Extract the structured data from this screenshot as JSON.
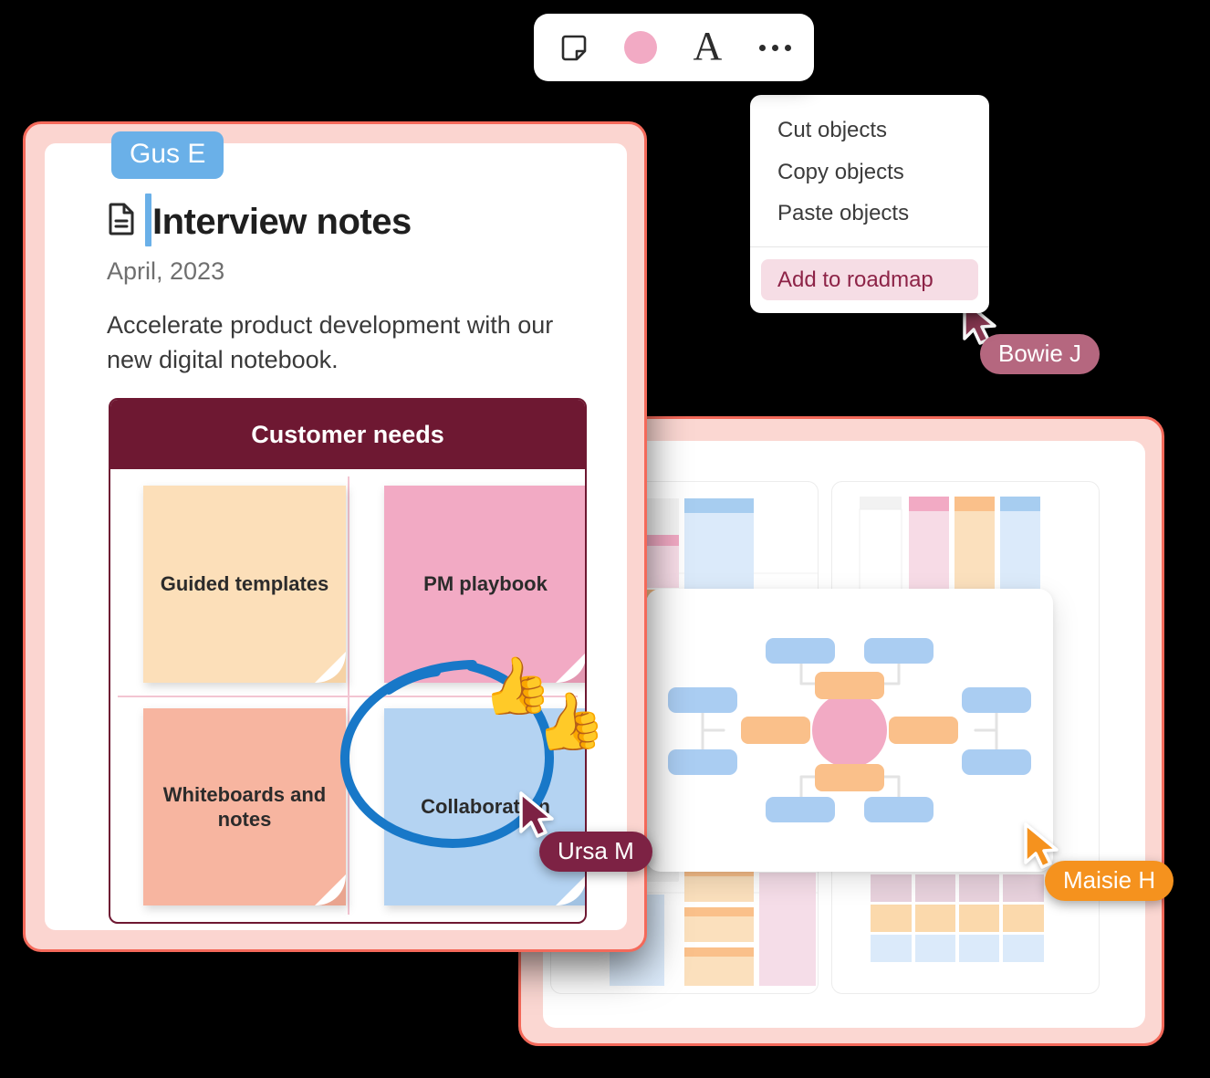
{
  "toolbar": {
    "items": [
      {
        "name": "sticky-note-tool",
        "icon": "sticky-note-icon",
        "label": ""
      },
      {
        "name": "color-swatch-tool",
        "icon": "color-circle-icon",
        "label": "",
        "color": "#f2aac4"
      },
      {
        "name": "text-tool",
        "icon": "text-A-icon",
        "label": "A"
      },
      {
        "name": "more-options",
        "icon": "ellipsis-icon",
        "label": ""
      }
    ]
  },
  "context_menu": {
    "items": [
      {
        "label": "Cut objects",
        "highlight": false
      },
      {
        "label": "Copy objects",
        "highlight": false
      },
      {
        "label": "Paste objects",
        "highlight": false
      }
    ],
    "action": {
      "label": "Add to roadmap",
      "highlight": true,
      "bg": "#f6dde5",
      "fg": "#8d2347"
    }
  },
  "document": {
    "icon": "document-icon",
    "title": "Interview notes",
    "date": "April, 2023",
    "body": "Accelerate product development with our new digital notebook.",
    "border_color": "#f4695a",
    "frame_color": "#fbd5d0"
  },
  "matrix": {
    "header": "Customer needs",
    "header_bg": "#6e1832",
    "border_color": "#6e1832",
    "notes": [
      {
        "label": "Guided templates",
        "color": "#fcdfb9",
        "quadrant": "top-left"
      },
      {
        "label": "PM playbook",
        "color": "#f2aac4",
        "quadrant": "top-right"
      },
      {
        "label": "Whiteboards and notes",
        "color": "#f7b5a0",
        "quadrant": "bottom-left"
      },
      {
        "label": "Collaboration",
        "color": "#b4d3f2",
        "quadrant": "bottom-right"
      }
    ],
    "annotation": {
      "type": "hand-drawn-circle",
      "color": "#1878c8",
      "target": "Collaboration"
    },
    "reactions": [
      "👍",
      "👍"
    ]
  },
  "board": {
    "border_color": "#f4695a",
    "frame_color": "#fbd7d2",
    "panels": [
      {
        "name": "timeline-panel",
        "position": "left"
      },
      {
        "name": "kanban-panel",
        "position": "right"
      }
    ]
  },
  "mindmap": {
    "center_color": "#f2aac4",
    "branch_color": "#fac08a",
    "leaf_color": "#aacdf2",
    "branches": 4,
    "leaves": 8
  },
  "cursors": [
    {
      "name": "Gus E",
      "color": "#6ab0e8",
      "shape": "text-caret"
    },
    {
      "name": "Bowie J",
      "color": "#b5677f",
      "shape": "arrow"
    },
    {
      "name": "Ursa M",
      "color": "#7d2244",
      "shape": "arrow"
    },
    {
      "name": "Maisie H",
      "color": "#f5921e",
      "shape": "arrow"
    }
  ]
}
